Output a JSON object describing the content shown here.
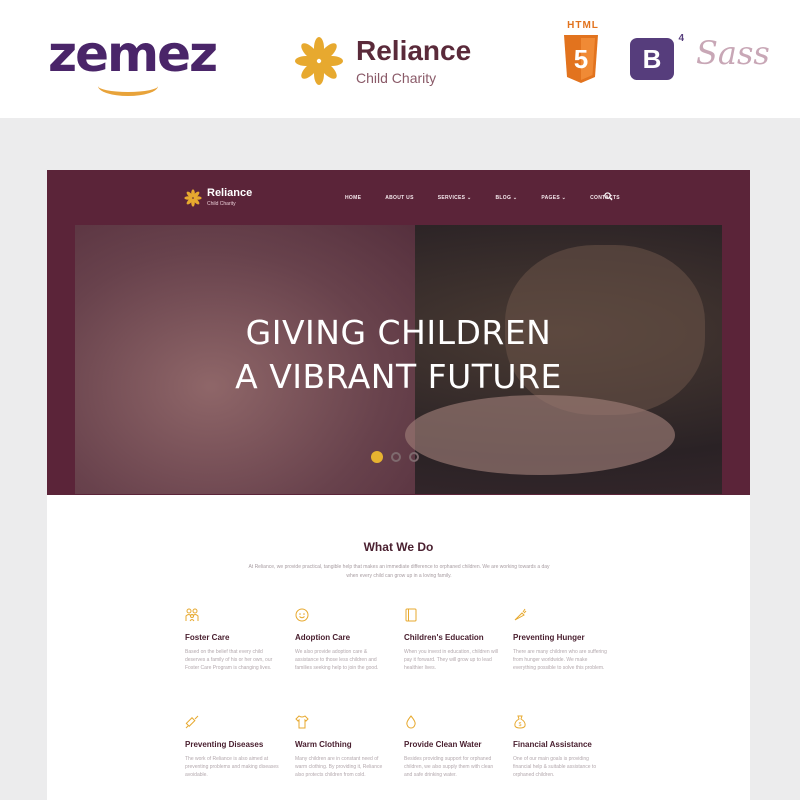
{
  "marketing": {
    "vendor_logo": "zemez",
    "brand": {
      "name": "Reliance",
      "tagline": "Child Charity",
      "logo_icon": "flower-icon"
    },
    "tech_badges": [
      {
        "name": "html5-icon",
        "label": "HTML",
        "glyph": "5"
      },
      {
        "name": "bootstrap-icon",
        "glyph": "B",
        "version": "4"
      },
      {
        "name": "sass-icon",
        "label": "Sass"
      }
    ]
  },
  "site": {
    "logo": {
      "name": "Reliance",
      "tagline": "Child Charity"
    },
    "nav": [
      "HOME",
      "ABOUT US",
      "SERVICES ⌄",
      "BLOG ⌄",
      "PAGES ⌄",
      "CONTACTS"
    ],
    "hero": {
      "line1": "GIVING CHILDREN",
      "line2": "A VIBRANT FUTURE",
      "slides": 3,
      "active_slide": 1
    },
    "what_we_do": {
      "title": "What We Do",
      "intro": "At Reliance, we provide practical, tangible help that makes an immediate difference to orphaned children. We are working towards a day when every child can grow up in a loving family."
    },
    "features": [
      {
        "icon": "family-icon",
        "title": "Foster Care",
        "text": "Based on the belief that every child deserves a family of his or her own, our Foster Care Program is changing lives."
      },
      {
        "icon": "smile-icon",
        "title": "Adoption Care",
        "text": "We also provide adoption care & assistance to those less children and families seeking help to join the good."
      },
      {
        "icon": "book-icon",
        "title": "Children's Education",
        "text": "When you invest in education, children will pay it forward. They will grow up to lead healthier lives."
      },
      {
        "icon": "carrot-icon",
        "title": "Preventing Hunger",
        "text": "There are many children who are suffering from hunger worldwide. We make everything possible to solve this problem."
      },
      {
        "icon": "syringe-icon",
        "title": "Preventing Diseases",
        "text": "The work of Reliance is also aimed at preventing problems and making diseases avoidable."
      },
      {
        "icon": "shirt-icon",
        "title": "Warm Clothing",
        "text": "Many children are in constant need of warm clothing. By providing it, Reliance also protects children from cold."
      },
      {
        "icon": "drop-icon",
        "title": "Provide Clean Water",
        "text": "Besides providing support for orphaned children, we also supply them with clean and safe drinking water."
      },
      {
        "icon": "moneybag-icon",
        "title": "Financial Assistance",
        "text": "One of our main goals is providing financial help & suitable assistance to orphaned children."
      }
    ]
  },
  "colors": {
    "accent": "#5b2439",
    "gold": "#e7b330",
    "text_dark": "#4a2030"
  }
}
